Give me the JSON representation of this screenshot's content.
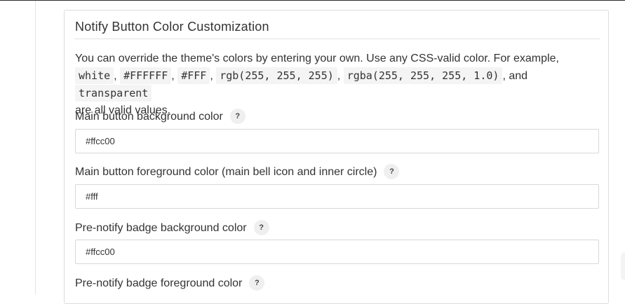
{
  "panel": {
    "title": "Notify Button Color Customization",
    "description": {
      "intro": "You can override the theme's colors by entering your own. Use any CSS-valid color. For example,",
      "examples": [
        "white",
        "#FFFFFF",
        "#FFF",
        "rgb(255, 255, 255)",
        "rgba(255, 255, 255, 1.0)",
        "transparent"
      ],
      "separator": ",",
      "conjunction": ", and",
      "outro": "are all valid values."
    },
    "help_symbol": "?",
    "fields": [
      {
        "label": "Main button background color",
        "value": "#ffcc00"
      },
      {
        "label": "Main button foreground color (main bell icon and inner circle)",
        "value": "#fff"
      },
      {
        "label": "Pre-notify badge background color",
        "value": "#ffcc00"
      },
      {
        "label": "Pre-notify badge foreground color",
        "value": ""
      }
    ]
  }
}
